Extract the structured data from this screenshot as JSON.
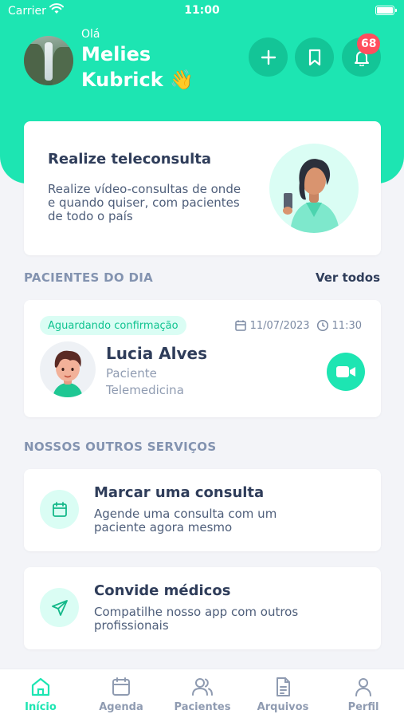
{
  "status_bar": {
    "carrier": "Carrier",
    "time": "11:00"
  },
  "header": {
    "greeting": "Olá",
    "user_name": "Melies Kubrick 👋",
    "notification_count": "68"
  },
  "teleconsulta": {
    "title": "Realize teleconsulta",
    "description": "Realize vídeo-consultas de onde e quando quiser, com pacientes de todo o país"
  },
  "patients_section": {
    "title": "PACIENTES DO DIA",
    "see_all": "Ver todos",
    "appointment": {
      "status": "Aguardando confirmação",
      "date": "11/07/2023",
      "time": "11:30",
      "name": "Lucia Alves",
      "role": "Paciente",
      "type": "Telemedicina"
    }
  },
  "services_section": {
    "title": "NOSSOS OUTROS SERVIÇOS",
    "items": [
      {
        "title": "Marcar uma consulta",
        "description": "Agende uma consulta com um paciente agora mesmo",
        "icon": "calendar-icon"
      },
      {
        "title": "Convide médicos",
        "description": "Compatilhe nosso app com outros profissionais",
        "icon": "send-icon"
      }
    ]
  },
  "tabs": [
    {
      "label": "Início",
      "icon": "home-icon",
      "active": true
    },
    {
      "label": "Agenda",
      "icon": "calendar-icon",
      "active": false
    },
    {
      "label": "Pacientes",
      "icon": "users-icon",
      "active": false
    },
    {
      "label": "Arquivos",
      "icon": "file-icon",
      "active": false
    },
    {
      "label": "Perfil",
      "icon": "user-icon",
      "active": false
    }
  ],
  "colors": {
    "primary": "#1de5b2",
    "primary_dark": "#13c597",
    "badge": "#ff4e5e",
    "text_dark": "#2f3d5a",
    "background": "#f3f4f8"
  }
}
